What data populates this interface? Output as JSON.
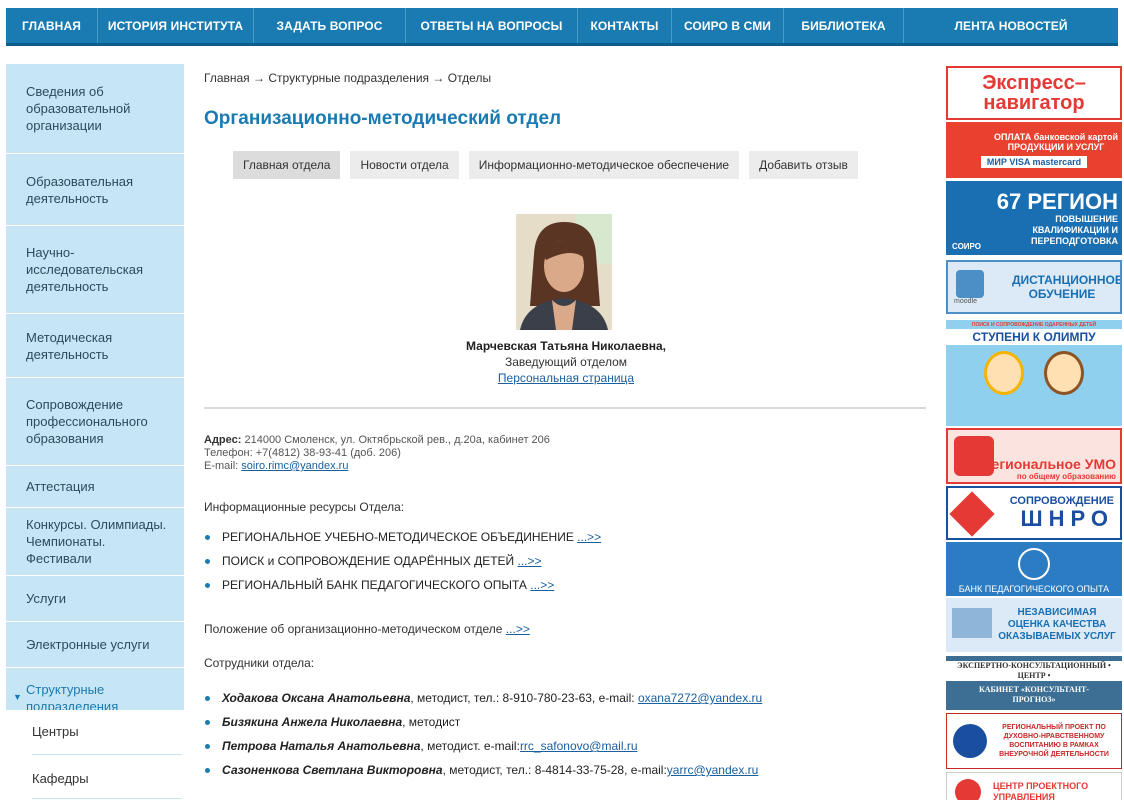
{
  "topnav": {
    "items": [
      "ГЛАВНАЯ",
      "ИСТОРИЯ ИНСТИТУТА",
      "ЗАДАТЬ ВОПРОС",
      "ОТВЕТЫ НА ВОПРОСЫ",
      "КОНТАКТЫ",
      "СОИРО В СМИ",
      "БИБЛИОТЕКА",
      "ЛЕНТА НОВОСТЕЙ"
    ]
  },
  "sidebar": {
    "items": [
      "Сведения об образовательной организации",
      "Образовательная деятельность",
      "Научно-исследовательская деятельность",
      "Методическая деятельность",
      "Сопровождение профессионального образования",
      "Аттестация",
      "Конкурсы. Олимпиады. Чемпионаты. Фестивали",
      "Услуги",
      "Электронные услуги",
      "Структурные подразделения"
    ],
    "sub_items": [
      "Центры",
      "Кафедры"
    ]
  },
  "breadcrumb": {
    "items": [
      "Главная",
      "Структурные подразделения",
      "Отделы"
    ],
    "separator": "→"
  },
  "page": {
    "title": "Организационно-методический отдел"
  },
  "tabs": [
    "Главная отдела",
    "Новости отдела",
    "Информационно-методическое обеспечение",
    "Добавить отзыв"
  ],
  "head": {
    "name": "Марчевская Татьяна Николаевна,",
    "position": "Заведующий отделом",
    "link": "Персональная страница"
  },
  "contacts": {
    "address_label": "Адрес:",
    "address": "214000 Смоленск, ул. Октябрьской рев., д.20а, кабинет 206",
    "phone": "Телефон: +7(4812) 38-93-41 (доб. 206)",
    "email_label": "E-mail:",
    "email": "soiro.rimc@yandex.ru"
  },
  "resources": {
    "heading": "Информационные ресурсы Отдела:",
    "items": [
      {
        "text": "РЕГИОНАЛЬНОЕ УЧЕБНО-МЕТОДИЧЕСКОЕ ОБЪЕДИНЕНИЕ",
        "link": "...>>"
      },
      {
        "text": "ПОИСК и СОПРОВОЖДЕНИЕ ОДАРЁННЫХ ДЕТЕЙ",
        "link": "...>>"
      },
      {
        "text": "РЕГИОНАЛЬНЫЙ БАНК ПЕДАГОГИЧЕСКОГО ОПЫТА",
        "link": "...>>"
      }
    ]
  },
  "regulation": {
    "text": "Положение об организационно-методическом отделе",
    "link": "...>>"
  },
  "staff": {
    "heading": "Сотрудники отдела:",
    "items": [
      {
        "name": "Ходакова Оксана Анатольевна",
        "info": ", методист, тел.: 8-910-780-23-63, e-mail: ",
        "email": "oxana7272@yandex.ru"
      },
      {
        "name": "Бизякина Анжела Николаевна",
        "info": ", методист",
        "email": ""
      },
      {
        "name": "Петрова Наталья Анатольевна",
        "info": ", методист. e-mail:",
        "email": "rrc_safonovo@mail.ru"
      },
      {
        "name": "Сазоненкова Светлана Викторовна",
        "info": ", методист, тел.: 8-4814-33-75-28, e-mail:",
        "email": "yarrc@yandex.ru"
      }
    ]
  },
  "banners": [
    {
      "text": "Экспресс–навигатор"
    },
    {
      "text": "ОПЛАТА банковской картой ПРОДУКЦИИ И УСЛУГ",
      "sub": "МИР VISA mastercard"
    },
    {
      "text": "67 РЕГИОН",
      "sub": "ПОВЫШЕНИЕ КВАЛИФИКАЦИИ И ПЕРЕПОДГОТОВКА",
      "logo": "СОИРО"
    },
    {
      "text": "ДИСТАНЦИОННОЕ ОБУЧЕНИЕ",
      "logo": "moodle"
    },
    {
      "text": "ПОИСК И СОПРОВОЖДЕНИЕ ОДАРЕННЫХ ДЕТЕЙ",
      "sub": "СТУПЕНИ К ОЛИМПУ"
    },
    {
      "text": "Региональное УМО",
      "sub": "по общему образованию"
    },
    {
      "text": "СОПРОВОЖДЕНИЕ",
      "sub": "ШНРО"
    },
    {
      "text": "БАНК ПЕДАГОГИЧЕСКОГО ОПЫТА"
    },
    {
      "text": "НЕЗАВИСИМАЯ ОЦЕНКА КАЧЕСТВА ОКАЗЫВАЕМЫХ УСЛУГ"
    },
    {
      "text": "ЭКСПЕРТНО-КОНСУЛЬТАЦИОННЫЙ • ЦЕНТР •",
      "sub": "КАБИНЕТ «КОНСУЛЬТАНТ-ПРОГНОЗ»"
    },
    {
      "text": "РЕГИОНАЛЬНЫЙ ПРОЕКТ ПО ДУХОВНО-НРАВСТВЕННОМУ ВОСПИТАНИЮ В РАМКАХ ВНЕУРОЧНОЙ ДЕЯТЕЛЬНОСТИ"
    },
    {
      "text": "ЦЕНТР ПРОЕКТНОГО УПРАВЛЕНИЯ"
    }
  ],
  "colors": {
    "nav": "#1a7bb3",
    "sidebar": "#c6e6f6",
    "title": "#1a7bb3",
    "link": "#1a5fa0"
  }
}
